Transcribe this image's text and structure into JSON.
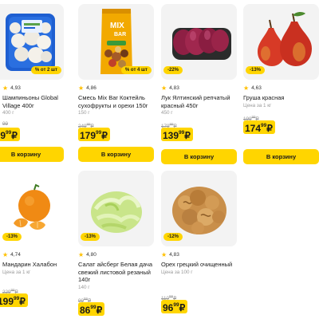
{
  "currency": "₽",
  "products": [
    {
      "id": "mushrooms",
      "badge": "% от 2 шт",
      "rating": "4,93",
      "name": "Шампиньоны Global Village 400г",
      "sub": "400 г",
      "old_price": "99",
      "old_cents": "",
      "price": "169",
      "cents": "99",
      "cart_label": "В корзину"
    },
    {
      "id": "mix-bar",
      "badge": "% от 4 шт",
      "rating": "4,86",
      "name": "Смесь Mix Bar Коктейль сухофрукты и орехи 150г",
      "sub": "150 г",
      "old_price": "249",
      "old_cents": "99",
      "price": "179",
      "cents": "99",
      "cart_label": "В корзину"
    },
    {
      "id": "onion",
      "badge": "-22%",
      "rating": "4,83",
      "name": "Лук Ялтинский репчатый красный 450г",
      "sub": "450 г",
      "old_price": "179",
      "old_cents": "99",
      "price": "139",
      "cents": "99",
      "cart_label": "В корзину"
    },
    {
      "id": "pear",
      "badge": "-13%",
      "rating": "4,63",
      "name": "Груша красная",
      "sub": "Цена за 1 кг",
      "old_price": "199",
      "old_cents": "99",
      "price": "174",
      "cents": "99",
      "cart_label": "В корзину"
    },
    {
      "id": "mandarin",
      "badge": "-13%",
      "rating": "4,74",
      "name": "Мандарин Халабон",
      "sub": "Цена за 1 кг",
      "old_price": "229",
      "old_cents": "99",
      "price": "199",
      "cents": "99",
      "cart_label": ""
    },
    {
      "id": "iceberg",
      "badge": "-13%",
      "rating": "4,80",
      "name": "Салат айсберг Белая дача свежий листовой резаный 140г",
      "sub": "140 г",
      "old_price": "99",
      "old_cents": "99",
      "price": "86",
      "cents": "99",
      "cart_label": ""
    },
    {
      "id": "walnut",
      "badge": "-12%",
      "rating": "4,83",
      "name": "Орех грецкий очищенный",
      "sub": "Цена за 100 г",
      "old_price": "110",
      "old_cents": "99",
      "price": "96",
      "cents": "99",
      "cart_label": ""
    }
  ]
}
